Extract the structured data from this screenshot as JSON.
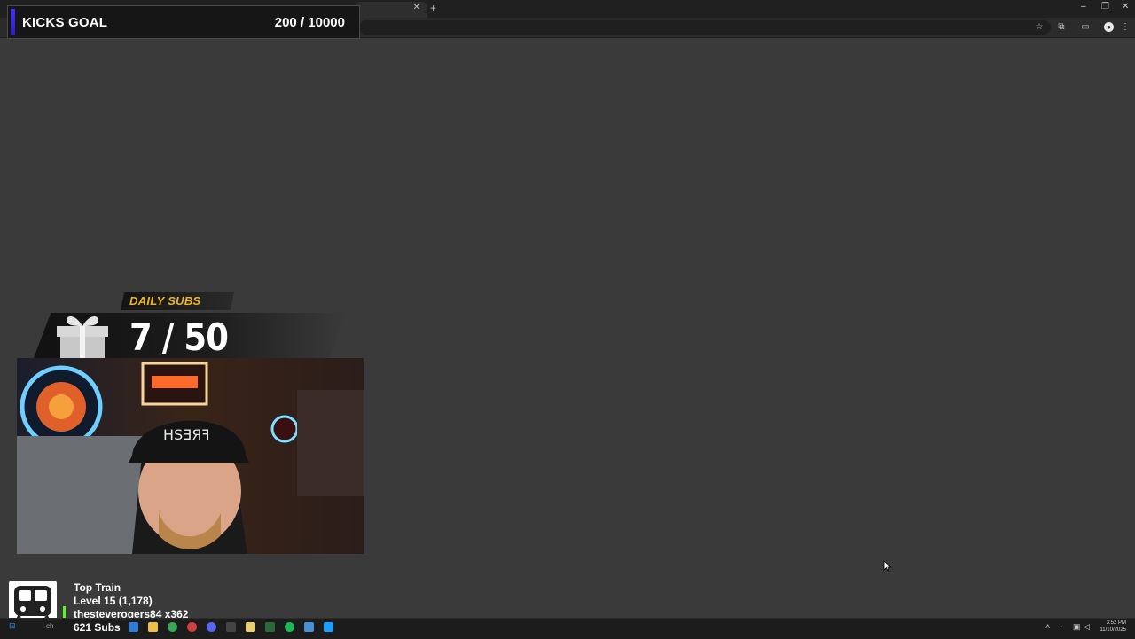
{
  "overlay": {
    "kicks_goal": {
      "label": "KICKS GOAL",
      "value": "200 / 10000",
      "accent": "#3b32ff"
    },
    "daily_subs": {
      "label": "DAILY SUBS",
      "count": "7 / 50",
      "accent": "#f2b520"
    },
    "top_train": {
      "title": "Top Train",
      "level": "Level 15  (1,178)",
      "user": "thesteverogers84 x362",
      "subs": "621 Subs",
      "accent": "#53fc18"
    }
  },
  "browser": {
    "icons": [
      "star-icon",
      "extensions-icon",
      "sidebar-icon",
      "profile-icon",
      "menu-icon"
    ],
    "window_controls": [
      "minimize-icon",
      "restore-icon",
      "close-icon"
    ]
  },
  "taskbar": {
    "search_label": "ch",
    "time": "3:52 PM",
    "date": "11/10/2025"
  }
}
